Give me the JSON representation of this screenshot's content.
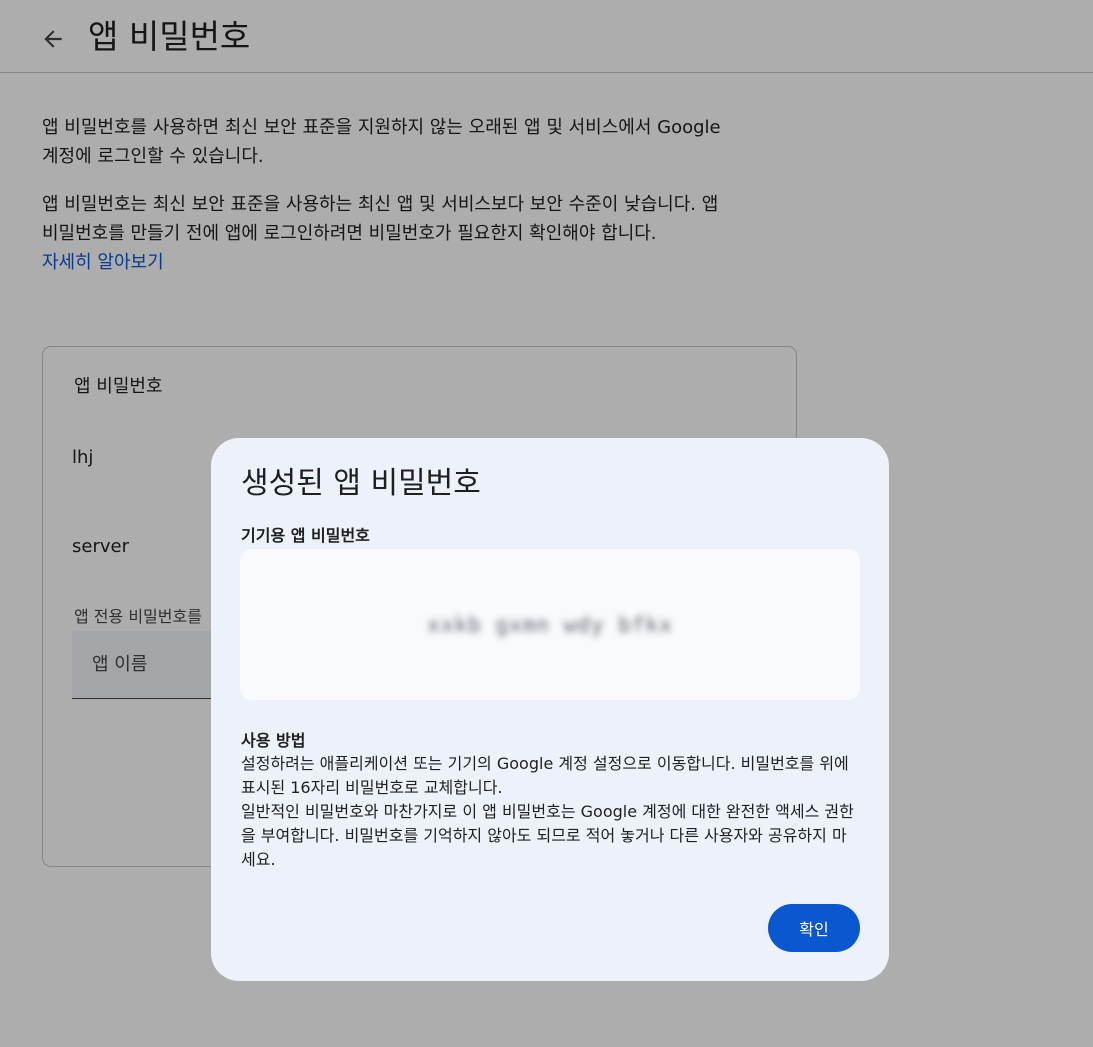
{
  "header": {
    "title": "앱 비밀번호",
    "back_icon": "arrow-back-icon"
  },
  "intro": {
    "paragraph1": "앱 비밀번호를 사용하면 최신 보안 표준을 지원하지 않는 오래된 앱 및 서비스에서 Google 계정에 로그인할 수 있습니다.",
    "paragraph2": "앱 비밀번호는 최신 보안 표준을 사용하는 최신 앱 및 서비스보다 보안 수준이 낮습니다. 앱 비밀번호를 만들기 전에 앱에 로그인하려면 비밀번호가 필요한지 확인해야 합니다.",
    "learn_more": "자세히 알아보기"
  },
  "card": {
    "title": "앱 비밀번호",
    "items": [
      {
        "label": "lhj"
      },
      {
        "label": "server"
      }
    ],
    "create_label": "앱 전용 비밀번호를",
    "input_placeholder": "앱 이름"
  },
  "dialog": {
    "title": "생성된 앱 비밀번호",
    "password_label": "기기용 앱 비밀번호",
    "password_value": "xxkb gxmn wdy bfkx",
    "usage_title": "사용 방법",
    "usage_paragraph1": "설정하려는 애플리케이션 또는 기기의 Google 계정 설정으로 이동합니다. 비밀번호를 위에 표시된 16자리 비밀번호로 교체합니다.",
    "usage_paragraph2": "일반적인 비밀번호와 마찬가지로 이 앱 비밀번호는 Google 계정에 대한 완전한 액세스 권한을 부여합니다. 비밀번호를 기억하지 않아도 되므로 적어 놓거나 다른 사용자와 공유하지 마세요.",
    "confirm_label": "확인"
  },
  "colors": {
    "accent": "#0b57d0",
    "dialog_bg": "#edf2fa",
    "scrim": "rgba(0,0,0,0.32)"
  }
}
